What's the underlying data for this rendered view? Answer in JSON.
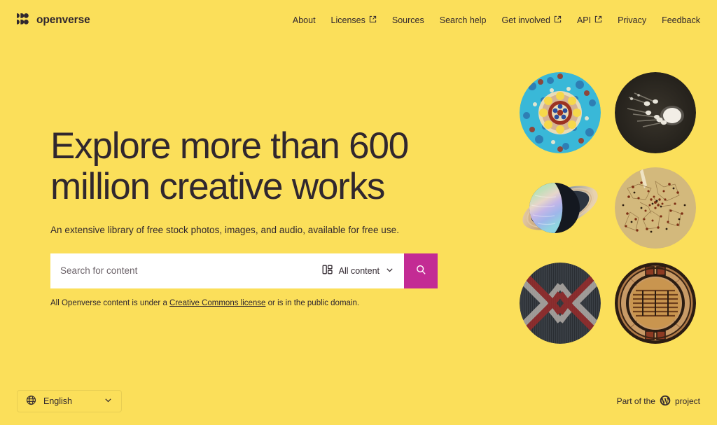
{
  "brand": {
    "name": "openverse",
    "logo_icon": "openverse-logo-mark"
  },
  "nav": {
    "items": [
      {
        "label": "About",
        "external": false
      },
      {
        "label": "Licenses",
        "external": true
      },
      {
        "label": "Sources",
        "external": false
      },
      {
        "label": "Search help",
        "external": false
      },
      {
        "label": "Get involved",
        "external": true
      },
      {
        "label": "API",
        "external": true
      },
      {
        "label": "Privacy",
        "external": false
      },
      {
        "label": "Feedback",
        "external": false
      }
    ]
  },
  "hero": {
    "headline": "Explore more than 600 million creative works",
    "subtitle": "An extensive library of free stock photos, images, and audio, available for free use."
  },
  "search": {
    "placeholder": "Search for content",
    "value": "",
    "content_type_label": "All content",
    "content_type_icon": "all-content-icon",
    "chevron_icon": "chevron-down-icon",
    "button_icon": "search-icon",
    "button_color": "#c32b94"
  },
  "license_note": {
    "prefix": "All Openverse content is under a ",
    "link_text": "Creative Commons license",
    "suffix": " or is in the public domain."
  },
  "collage": {
    "images": [
      {
        "name": "iznik-ceramic-plate",
        "alt": "Turquoise Iznik ceramic plate with floral medallion"
      },
      {
        "name": "comet-astronomical-plate",
        "alt": "Dark astronomical plate showing comets with bright tails"
      },
      {
        "name": "ringed-planet",
        "alt": "Pastel ringed planet resembling Saturn"
      },
      {
        "name": "antique-star-chart",
        "alt": "Antique parchment star chart with constellation dots"
      },
      {
        "name": "woven-textile-chevron",
        "alt": "Dark textile with red and grey chevron X pattern"
      },
      {
        "name": "woven-basket-tray",
        "alt": "Woven basket tray with concentric decorated rings"
      }
    ]
  },
  "footer": {
    "language": {
      "label": "English",
      "globe_icon": "globe-icon",
      "chevron_icon": "chevron-down-icon"
    },
    "wordpress_note": {
      "prefix": "Part of the",
      "icon": "wordpress-icon",
      "suffix": "project"
    }
  },
  "colors": {
    "background": "#fbdf5a",
    "text": "#30272e",
    "accent": "#c32b94",
    "surface": "#ffffff"
  }
}
